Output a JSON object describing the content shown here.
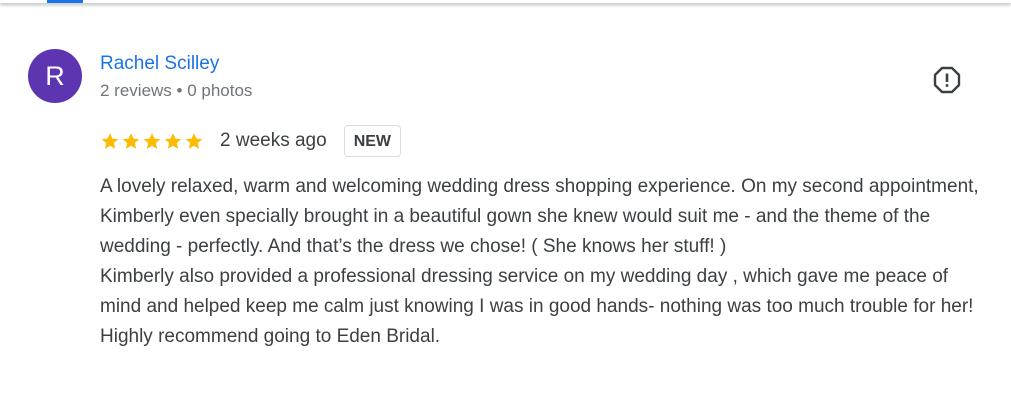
{
  "review": {
    "avatar_letter": "R",
    "author_name": "Rachel Scilley",
    "author_meta": "2 reviews • 0 photos",
    "rating": 5,
    "time_ago": "2 weeks ago",
    "badge": "NEW",
    "text": "A lovely relaxed, warm and welcoming wedding dress shopping experience. On my second appointment, Kimberly even specially brought in a beautiful gown she knew would suit me - and the theme of the wedding - perfectly. And that’s the dress we chose! ( She knows her stuff! )\nKimberly also provided a professional dressing service on my wedding day , which gave me peace of mind and helped keep me calm just knowing I was in good hands- nothing was too much trouble for her! Highly recommend going to Eden Bridal."
  },
  "icons": {
    "flag": "report-flag-icon",
    "star": "star-icon"
  },
  "colors": {
    "avatar_bg": "#5e35b1",
    "link": "#1a73e8",
    "star": "#fbbc04",
    "text": "#3c4043",
    "meta": "#70757a"
  }
}
